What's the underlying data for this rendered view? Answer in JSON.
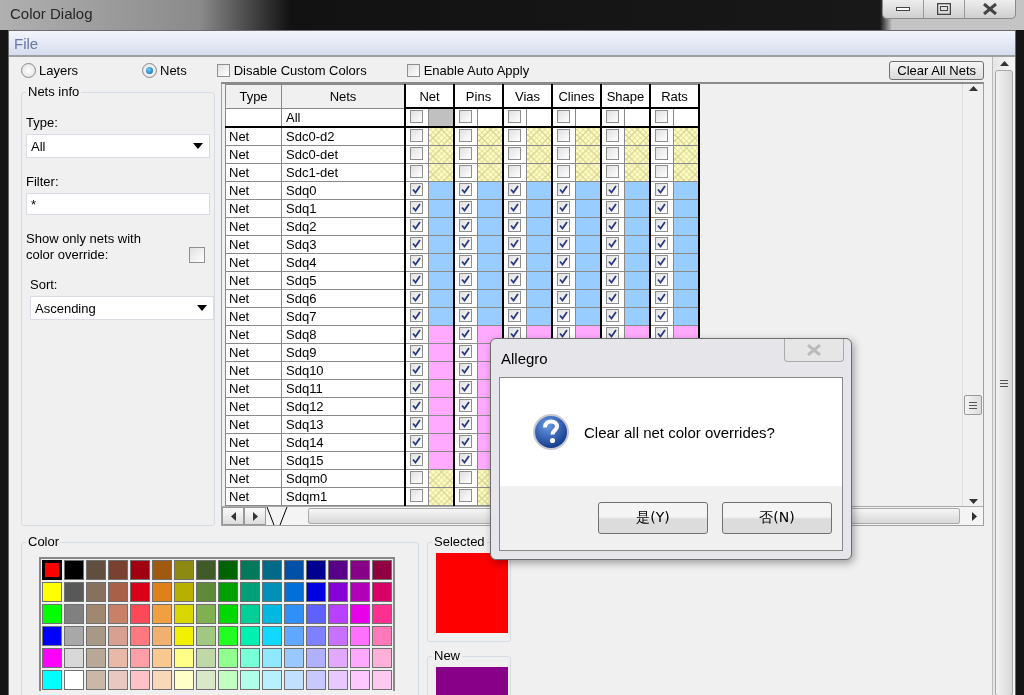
{
  "window": {
    "title": "Color Dialog"
  },
  "menu": [
    "File"
  ],
  "mode_options": [
    {
      "label": "Layers",
      "selected": false
    },
    {
      "label": "Nets",
      "selected": true
    }
  ],
  "options": [
    {
      "label": "Disable Custom Colors",
      "checked": false
    },
    {
      "label": "Enable Auto Apply",
      "checked": false
    }
  ],
  "clear_button": "Clear All Nets",
  "nets_info": {
    "title": "Nets info",
    "type_label": "Type:",
    "type_value": "All",
    "filter_label": "Filter:",
    "filter_value": "*",
    "override_label": "Show only nets with color override:",
    "override_checked": false,
    "sort_label": "Sort:",
    "sort_value": "Ascending"
  },
  "table": {
    "columns": [
      "Type",
      "Nets"
    ],
    "properties": [
      "Net",
      "Pins",
      "Vias",
      "Clines",
      "Shape",
      "Rats"
    ],
    "all_row": {
      "label": "All",
      "checked": false
    },
    "rows": [
      {
        "type": "Net",
        "name": "Sdc0-d2",
        "checked": false
      },
      {
        "type": "Net",
        "name": "Sdc0-det",
        "checked": false
      },
      {
        "type": "Net",
        "name": "Sdc1-det",
        "checked": false
      },
      {
        "type": "Net",
        "name": "Sdq0",
        "checked": true,
        "color": "#99ccff"
      },
      {
        "type": "Net",
        "name": "Sdq1",
        "checked": true,
        "color": "#99ccff"
      },
      {
        "type": "Net",
        "name": "Sdq2",
        "checked": true,
        "color": "#99ccff"
      },
      {
        "type": "Net",
        "name": "Sdq3",
        "checked": true,
        "color": "#99ccff"
      },
      {
        "type": "Net",
        "name": "Sdq4",
        "checked": true,
        "color": "#99ccff"
      },
      {
        "type": "Net",
        "name": "Sdq5",
        "checked": true,
        "color": "#99ccff"
      },
      {
        "type": "Net",
        "name": "Sdq6",
        "checked": true,
        "color": "#99ccff"
      },
      {
        "type": "Net",
        "name": "Sdq7",
        "checked": true,
        "color": "#99ccff"
      },
      {
        "type": "Net",
        "name": "Sdq8",
        "checked": true,
        "color": "#ffaaff"
      },
      {
        "type": "Net",
        "name": "Sdq9",
        "checked": true,
        "color": "#ffaaff"
      },
      {
        "type": "Net",
        "name": "Sdq10",
        "checked": true,
        "color": "#ffaaff"
      },
      {
        "type": "Net",
        "name": "Sdq11",
        "checked": true,
        "color": "#ffaaff"
      },
      {
        "type": "Net",
        "name": "Sdq12",
        "checked": true,
        "color": "#ffaaff"
      },
      {
        "type": "Net",
        "name": "Sdq13",
        "checked": true,
        "color": "#ffaaff"
      },
      {
        "type": "Net",
        "name": "Sdq14",
        "checked": true,
        "color": "#ffaaff"
      },
      {
        "type": "Net",
        "name": "Sdq15",
        "checked": true,
        "color": "#ffaaff"
      },
      {
        "type": "Net",
        "name": "Sdqm0",
        "checked": false
      },
      {
        "type": "Net",
        "name": "Sdqm1",
        "checked": false
      }
    ]
  },
  "palette": {
    "title": "Color",
    "swatches": [
      {
        "color": "#ff0000",
        "selected": true
      },
      {
        "color": "#000000",
        "selected": false
      },
      {
        "color": "#604e40",
        "selected": false
      },
      {
        "color": "#7a4030",
        "selected": false
      },
      {
        "color": "#a00010",
        "selected": false
      },
      {
        "color": "#a05a10",
        "selected": false
      },
      {
        "color": "#8c8a10",
        "selected": false
      },
      {
        "color": "#405a28",
        "selected": false
      },
      {
        "color": "#006400",
        "selected": false
      },
      {
        "color": "#007a5a",
        "selected": false
      },
      {
        "color": "#006a88",
        "selected": false
      },
      {
        "color": "#0050a8",
        "selected": false
      },
      {
        "color": "#000090",
        "selected": false
      },
      {
        "color": "#580088",
        "selected": false
      },
      {
        "color": "#880088",
        "selected": false
      },
      {
        "color": "#900040",
        "selected": false
      },
      {
        "color": "#ffff00",
        "selected": false
      },
      {
        "color": "#585858",
        "selected": false
      },
      {
        "color": "#887060",
        "selected": false
      },
      {
        "color": "#a86048",
        "selected": false
      },
      {
        "color": "#d80018",
        "selected": false
      },
      {
        "color": "#e08018",
        "selected": false
      },
      {
        "color": "#b8b000",
        "selected": false
      },
      {
        "color": "#608a38",
        "selected": false
      },
      {
        "color": "#00a000",
        "selected": false
      },
      {
        "color": "#00a078",
        "selected": false
      },
      {
        "color": "#0090b8",
        "selected": false
      },
      {
        "color": "#0070d8",
        "selected": false
      },
      {
        "color": "#0000e0",
        "selected": false
      },
      {
        "color": "#8800d8",
        "selected": false
      },
      {
        "color": "#b000b8",
        "selected": false
      },
      {
        "color": "#d80068",
        "selected": false
      },
      {
        "color": "#00ff00",
        "selected": false
      },
      {
        "color": "#808080",
        "selected": false
      },
      {
        "color": "#a08870",
        "selected": false
      },
      {
        "color": "#c88068",
        "selected": false
      },
      {
        "color": "#ff4858",
        "selected": false
      },
      {
        "color": "#f0a040",
        "selected": false
      },
      {
        "color": "#d8d800",
        "selected": false
      },
      {
        "color": "#80b050",
        "selected": false
      },
      {
        "color": "#00d800",
        "selected": false
      },
      {
        "color": "#00d098",
        "selected": false
      },
      {
        "color": "#00b8e0",
        "selected": false
      },
      {
        "color": "#3090f8",
        "selected": false
      },
      {
        "color": "#6060ff",
        "selected": false
      },
      {
        "color": "#b840ff",
        "selected": false
      },
      {
        "color": "#e800e8",
        "selected": false
      },
      {
        "color": "#ff3090",
        "selected": false
      },
      {
        "color": "#0000ff",
        "selected": false
      },
      {
        "color": "#a8a8a8",
        "selected": false
      },
      {
        "color": "#a89888",
        "selected": false
      },
      {
        "color": "#d8a090",
        "selected": false
      },
      {
        "color": "#ff7880",
        "selected": false
      },
      {
        "color": "#f0b070",
        "selected": false
      },
      {
        "color": "#f0f000",
        "selected": false
      },
      {
        "color": "#a0c880",
        "selected": false
      },
      {
        "color": "#20ff20",
        "selected": false
      },
      {
        "color": "#00f0b0",
        "selected": false
      },
      {
        "color": "#10d8ff",
        "selected": false
      },
      {
        "color": "#60a8ff",
        "selected": false
      },
      {
        "color": "#8080ff",
        "selected": false
      },
      {
        "color": "#c870ff",
        "selected": false
      },
      {
        "color": "#ff70ff",
        "selected": false
      },
      {
        "color": "#ff78b8",
        "selected": false
      },
      {
        "color": "#ff00ff",
        "selected": false
      },
      {
        "color": "#d8d8d8",
        "selected": false
      },
      {
        "color": "#b8a898",
        "selected": false
      },
      {
        "color": "#e8b8a8",
        "selected": false
      },
      {
        "color": "#ffa0a8",
        "selected": false
      },
      {
        "color": "#f8c890",
        "selected": false
      },
      {
        "color": "#ffff88",
        "selected": false
      },
      {
        "color": "#c0d8a8",
        "selected": false
      },
      {
        "color": "#90ff90",
        "selected": false
      },
      {
        "color": "#78ffd8",
        "selected": false
      },
      {
        "color": "#90e8ff",
        "selected": false
      },
      {
        "color": "#98c8ff",
        "selected": false
      },
      {
        "color": "#b0b0ff",
        "selected": false
      },
      {
        "color": "#e0a8ff",
        "selected": false
      },
      {
        "color": "#ffa8ff",
        "selected": false
      },
      {
        "color": "#ffb0d8",
        "selected": false
      },
      {
        "color": "#00ffff",
        "selected": false
      },
      {
        "color": "#ffffff",
        "selected": false
      },
      {
        "color": "#c8b8a8",
        "selected": false
      },
      {
        "color": "#e8c8c0",
        "selected": false
      },
      {
        "color": "#ffc0c8",
        "selected": false
      },
      {
        "color": "#f8d8b8",
        "selected": false
      },
      {
        "color": "#ffffc8",
        "selected": false
      },
      {
        "color": "#d8e8c8",
        "selected": false
      },
      {
        "color": "#c0ffc0",
        "selected": false
      },
      {
        "color": "#b0ffe8",
        "selected": false
      },
      {
        "color": "#b8f0ff",
        "selected": false
      },
      {
        "color": "#c0e0ff",
        "selected": false
      },
      {
        "color": "#c8c8ff",
        "selected": false
      },
      {
        "color": "#e8c8ff",
        "selected": false
      },
      {
        "color": "#ffc8ff",
        "selected": false
      },
      {
        "color": "#ffc8f0",
        "selected": false
      }
    ]
  },
  "selected_color": {
    "title": "Selected",
    "color": "#ff0000"
  },
  "new_color": {
    "title": "New",
    "color": "#880088"
  },
  "message_box": {
    "title": "Allegro",
    "message": "Clear all net color overrides?",
    "buttons": [
      "是(Y)",
      "否(N)"
    ]
  }
}
